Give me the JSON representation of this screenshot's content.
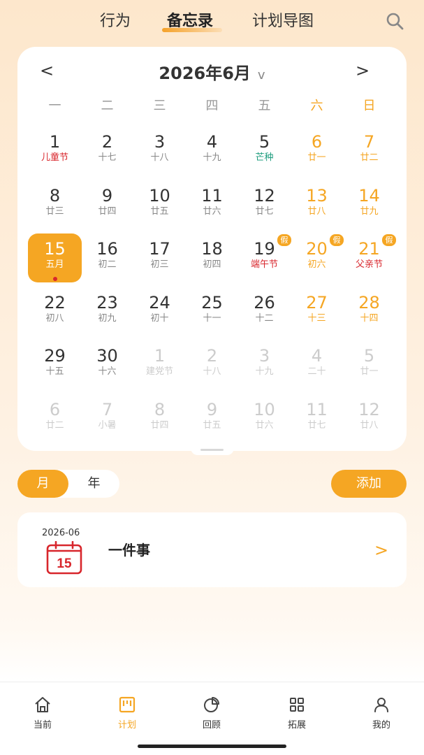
{
  "top_tabs": [
    {
      "label": "行为",
      "active": false
    },
    {
      "label": "备忘录",
      "active": true
    },
    {
      "label": "计划导图",
      "active": false
    }
  ],
  "calendar": {
    "prev": "<",
    "next": ">",
    "title": "2026年6月",
    "title_chevron": "v",
    "weekdays": [
      "一",
      "二",
      "三",
      "四",
      "五",
      "六",
      "日"
    ],
    "weeks": [
      [
        {
          "num": "1",
          "sub": "儿童节",
          "subtype": "holiday"
        },
        {
          "num": "2",
          "sub": "十七"
        },
        {
          "num": "3",
          "sub": "十八"
        },
        {
          "num": "4",
          "sub": "十九"
        },
        {
          "num": "5",
          "sub": "芒种",
          "subtype": "term"
        },
        {
          "num": "6",
          "sub": "廿一",
          "weekend": true
        },
        {
          "num": "7",
          "sub": "廿二",
          "weekend": true
        }
      ],
      [
        {
          "num": "8",
          "sub": "廿三"
        },
        {
          "num": "9",
          "sub": "廿四"
        },
        {
          "num": "10",
          "sub": "廿五"
        },
        {
          "num": "11",
          "sub": "廿六"
        },
        {
          "num": "12",
          "sub": "廿七"
        },
        {
          "num": "13",
          "sub": "廿八",
          "weekend": true
        },
        {
          "num": "14",
          "sub": "廿九",
          "weekend": true
        }
      ],
      [
        {
          "num": "15",
          "sub": "五月",
          "selected": true,
          "dot": true
        },
        {
          "num": "16",
          "sub": "初二"
        },
        {
          "num": "17",
          "sub": "初三"
        },
        {
          "num": "18",
          "sub": "初四"
        },
        {
          "num": "19",
          "sub": "端午节",
          "subtype": "holiday",
          "badge": "假"
        },
        {
          "num": "20",
          "sub": "初六",
          "weekend": true,
          "badge": "假"
        },
        {
          "num": "21",
          "sub": "父亲节",
          "weekend": true,
          "subtype": "holiday",
          "badge": "假"
        }
      ],
      [
        {
          "num": "22",
          "sub": "初八"
        },
        {
          "num": "23",
          "sub": "初九"
        },
        {
          "num": "24",
          "sub": "初十"
        },
        {
          "num": "25",
          "sub": "十一"
        },
        {
          "num": "26",
          "sub": "十二"
        },
        {
          "num": "27",
          "sub": "十三",
          "weekend": true
        },
        {
          "num": "28",
          "sub": "十四",
          "weekend": true
        }
      ],
      [
        {
          "num": "29",
          "sub": "十五"
        },
        {
          "num": "30",
          "sub": "十六"
        },
        {
          "num": "1",
          "sub": "建党节",
          "other": true
        },
        {
          "num": "2",
          "sub": "十八",
          "other": true
        },
        {
          "num": "3",
          "sub": "十九",
          "other": true
        },
        {
          "num": "4",
          "sub": "二十",
          "other": true
        },
        {
          "num": "5",
          "sub": "廿一",
          "other": true
        }
      ],
      [
        {
          "num": "6",
          "sub": "廿二",
          "other": true
        },
        {
          "num": "7",
          "sub": "小暑",
          "other": true
        },
        {
          "num": "8",
          "sub": "廿四",
          "other": true
        },
        {
          "num": "9",
          "sub": "廿五",
          "other": true
        },
        {
          "num": "10",
          "sub": "廿六",
          "other": true
        },
        {
          "num": "11",
          "sub": "廿七",
          "other": true
        },
        {
          "num": "12",
          "sub": "廿八",
          "other": true
        }
      ]
    ]
  },
  "segment": {
    "month": "月",
    "year": "年"
  },
  "add_label": "添加",
  "event": {
    "date": "2026-06",
    "icon_day": "15",
    "title": "一件事",
    "arrow": ">"
  },
  "bottom_nav": [
    {
      "label": "当前",
      "icon": "home-icon"
    },
    {
      "label": "计划",
      "icon": "plan-board-icon",
      "active": true
    },
    {
      "label": "回顾",
      "icon": "pie-chart-icon"
    },
    {
      "label": "拓展",
      "icon": "grid-icon"
    },
    {
      "label": "我的",
      "icon": "user-icon"
    }
  ],
  "colors": {
    "accent": "#F5A623",
    "holiday": "#D8262C",
    "solar_term": "#1E9C7E"
  }
}
